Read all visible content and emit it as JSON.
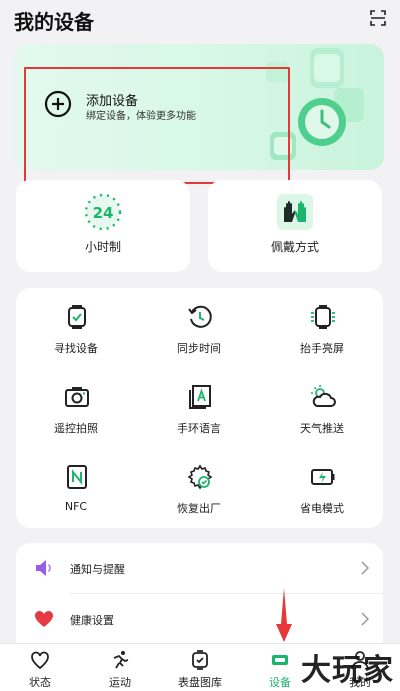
{
  "header": {
    "title": "我的设备"
  },
  "add_device": {
    "title": "添加设备",
    "subtitle": "绑定设备，体验更多功能"
  },
  "quick_cards": [
    {
      "label": "小时制",
      "icon": "24-hour-icon",
      "value": "24"
    },
    {
      "label": "佩戴方式",
      "icon": "wear-hands-icon"
    }
  ],
  "grid": [
    {
      "label": "寻找设备",
      "icon": "watch-find-icon"
    },
    {
      "label": "同步时间",
      "icon": "sync-time-icon"
    },
    {
      "label": "抬手亮屏",
      "icon": "raise-wake-icon"
    },
    {
      "label": "遥控拍照",
      "icon": "camera-icon"
    },
    {
      "label": "手环语言",
      "icon": "language-icon"
    },
    {
      "label": "天气推送",
      "icon": "weather-icon"
    },
    {
      "label": "NFC",
      "icon": "nfc-icon"
    },
    {
      "label": "恢复出厂",
      "icon": "factory-reset-icon"
    },
    {
      "label": "省电模式",
      "icon": "battery-saver-icon"
    }
  ],
  "settings_list": [
    {
      "label": "通知与提醒",
      "icon": "speaker-icon"
    },
    {
      "label": "健康设置",
      "icon": "heart-icon"
    }
  ],
  "tabbar": [
    {
      "label": "状态",
      "icon": "heart-outline-icon"
    },
    {
      "label": "运动",
      "icon": "running-icon"
    },
    {
      "label": "表盘图库",
      "icon": "watch-face-icon"
    },
    {
      "label": "设备",
      "icon": "device-icon",
      "active": true
    },
    {
      "label": "我的",
      "icon": "profile-icon"
    }
  ],
  "watermark": "大玩家",
  "colors": {
    "accent": "#1db56c",
    "annotation": "#e5383b",
    "heart": "#e53945",
    "speaker": "#9b5de5"
  }
}
